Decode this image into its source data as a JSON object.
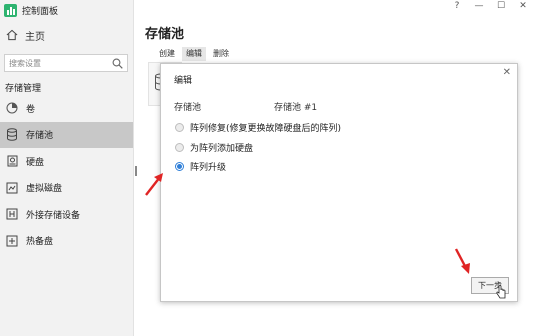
{
  "app": {
    "title": "控制面板",
    "logo_color": "#2db36f"
  },
  "sidebar": {
    "home_label": "主页",
    "search_placeholder": "搜索设置",
    "section_title": "存储管理",
    "items": [
      {
        "label": "卷",
        "icon": "volume-icon"
      },
      {
        "label": "存储池",
        "icon": "storage-pool-icon",
        "active": true
      },
      {
        "label": "硬盘",
        "icon": "hdd-icon"
      },
      {
        "label": "虚拟磁盘",
        "icon": "virtual-disk-icon"
      },
      {
        "label": "外接存储设备",
        "icon": "external-storage-icon"
      },
      {
        "label": "热备盘",
        "icon": "hot-spare-icon"
      }
    ]
  },
  "window_controls": {
    "help": "?",
    "minimize": "—",
    "maximize": "☐",
    "close": "✕"
  },
  "main": {
    "title": "存储池",
    "toolbar": {
      "create": "创建",
      "edit": "编辑",
      "delete": "删除"
    }
  },
  "dialog": {
    "title": "编辑",
    "close": "✕",
    "field_label": "存储池",
    "field_value": "存储池 #1",
    "options": [
      {
        "label": "阵列修复(修复更换故障硬盘后的阵列)",
        "selected": false
      },
      {
        "label": "为阵列添加硬盘",
        "selected": false
      },
      {
        "label": "阵列升级",
        "selected": true
      }
    ],
    "next_button": "下一步"
  },
  "colors": {
    "accent": "#2f7fd8",
    "annotation_arrow": "#e02424",
    "active_item_bg": "#c8c8c8"
  }
}
